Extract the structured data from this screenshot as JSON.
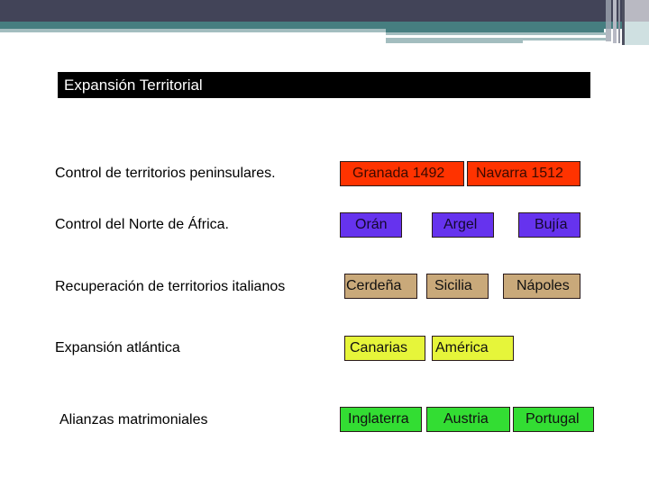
{
  "slide": {
    "title": "Expansión Territorial",
    "rows": [
      {
        "label": "Control de territorios peninsulares.",
        "color": "#ff3300",
        "items": [
          "Granada 1492",
          "Navarra 1512"
        ]
      },
      {
        "label": "Control del Norte de África.",
        "color": "#6633ee",
        "items": [
          "Orán",
          "Argel",
          "Bujía"
        ]
      },
      {
        "label": "Recuperación de territorios italianos",
        "color": "#c9a97a",
        "items": [
          "Cerdeña",
          "Sicilia",
          "Nápoles"
        ]
      },
      {
        "label": "Expansión atlántica",
        "color": "#e6f53a",
        "items": [
          "Canarias",
          "América"
        ]
      },
      {
        "label": "Alianzas  matrimoniales",
        "color": "#33dd33",
        "items": [
          "Inglaterra",
          "Austria",
          "Portugal"
        ]
      }
    ]
  },
  "theme": {
    "header_dark": "#424458",
    "header_teal": "#467e80",
    "header_light": "#a3bdbf"
  }
}
